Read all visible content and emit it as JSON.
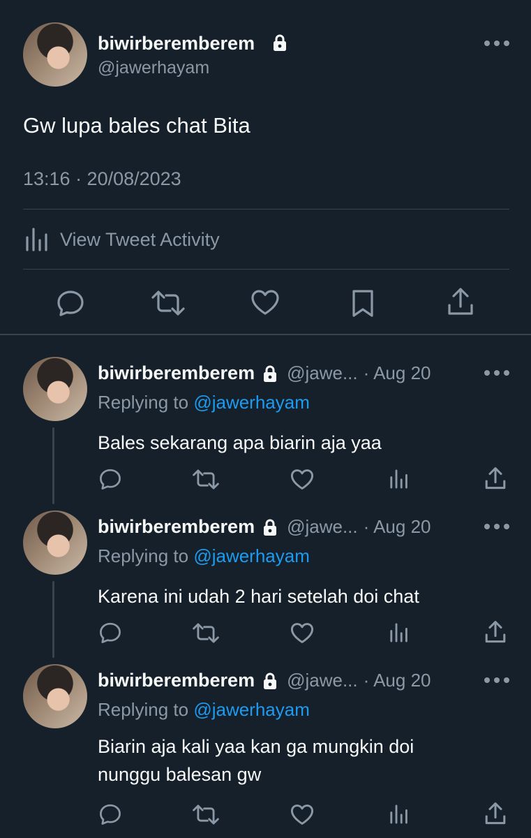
{
  "main_tweet": {
    "display_name": "biwirberemberem",
    "handle": "@jawerhayam",
    "text": "Gw lupa bales chat Bita",
    "timestamp": "13:16 · 20/08/2023",
    "activity_label": "View Tweet Activity"
  },
  "replies": [
    {
      "display_name": "biwirberemberem",
      "handle_truncated": "@jawe...",
      "date": "· Aug 20",
      "replying_prefix": "Replying to",
      "replying_handle": "@jawerhayam",
      "text_lines": [
        "Bales sekarang apa biarin aja yaa"
      ]
    },
    {
      "display_name": "biwirberemberem",
      "handle_truncated": "@jawe...",
      "date": "· Aug 20",
      "replying_prefix": "Replying to",
      "replying_handle": "@jawerhayam",
      "text_lines": [
        "Karena ini udah 2 hari setelah doi chat"
      ]
    },
    {
      "display_name": "biwirberemberem",
      "handle_truncated": "@jawe...",
      "date": "· Aug 20",
      "replying_prefix": "Replying to",
      "replying_handle": "@jawerhayam",
      "text_lines": [
        "Biarin aja kali yaa kan ga mungkin doi",
        "nunggu balesan gw"
      ]
    }
  ],
  "icons": [
    "lock-icon",
    "more-icon",
    "analytics-icon",
    "reply-icon",
    "retweet-icon",
    "like-icon",
    "bookmark-icon",
    "share-icon"
  ],
  "colors": {
    "background": "#15202b",
    "text": "#f7f9f9",
    "muted": "#8b98a5",
    "link": "#1d9bf0",
    "divider": "#38444d"
  }
}
